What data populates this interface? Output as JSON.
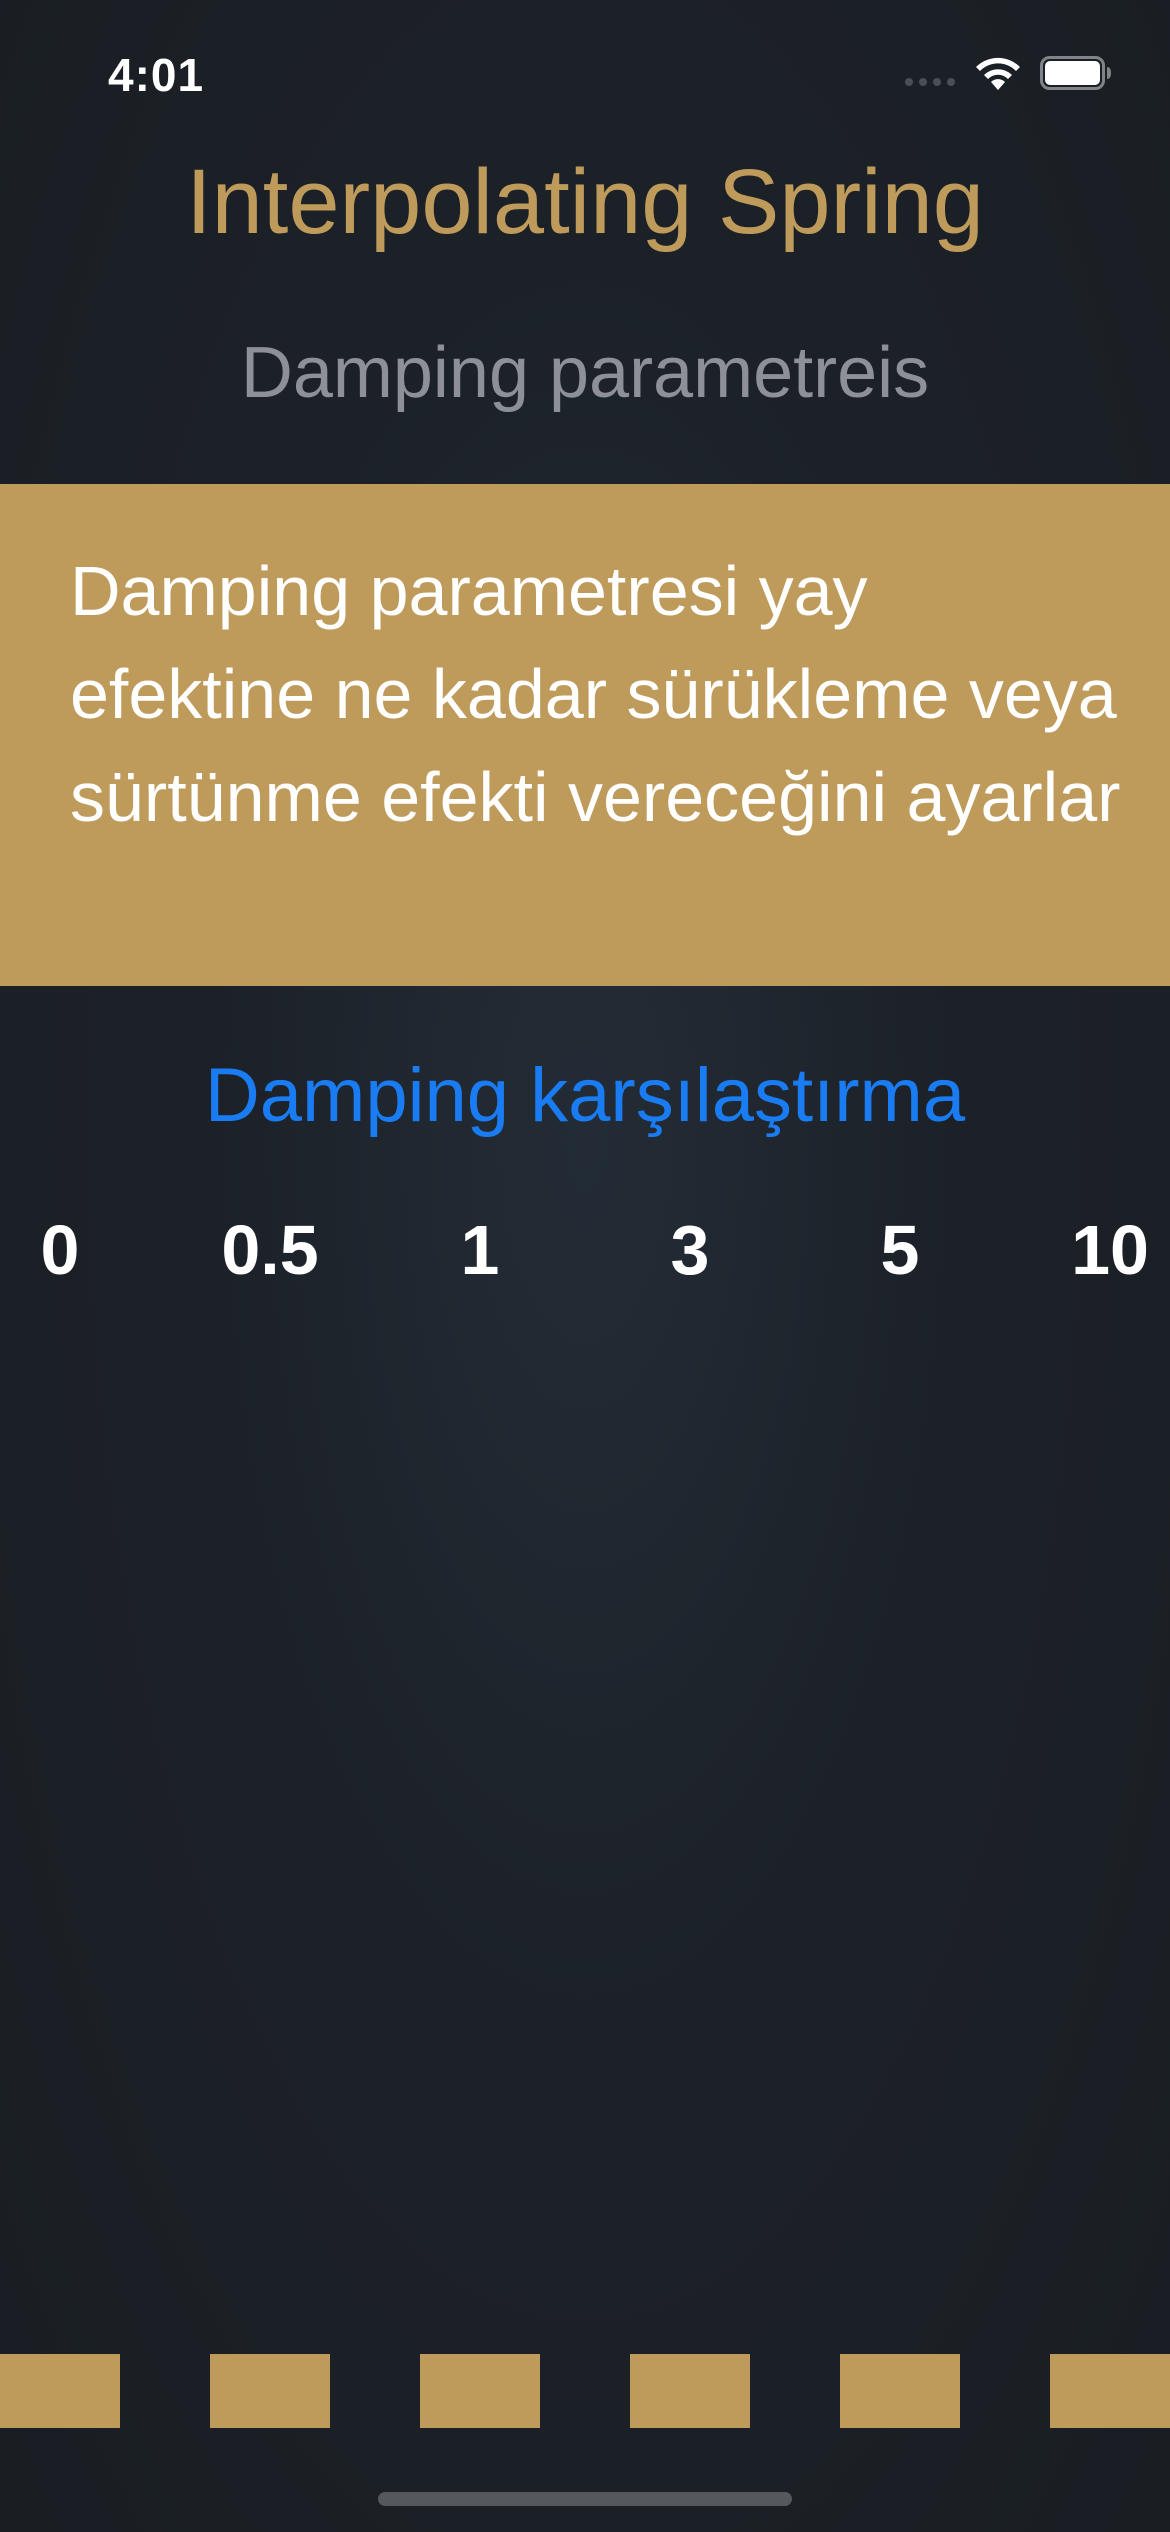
{
  "status_bar": {
    "time": "4:01"
  },
  "nav": {
    "title": "Interpolating Spring"
  },
  "subtitle": "Damping parametreis",
  "info_card": {
    "text": "Damping parametresi yay efektine ne kadar sürükleme veya sürtünme efekti vereceğini ayarlar"
  },
  "comparison": {
    "link_label": "Damping karşılaştırma"
  },
  "damping_values": [
    "0",
    "0.5",
    "1",
    "3",
    "5",
    "10"
  ],
  "colors": {
    "accent_gold": "#bf9b5b",
    "link_blue": "#1a7cf2",
    "subtitle_gray": "#8d9096",
    "background": "#1b1f24"
  },
  "icons": [
    "wifi-icon",
    "battery-icon",
    "cellular-signal-icon"
  ]
}
